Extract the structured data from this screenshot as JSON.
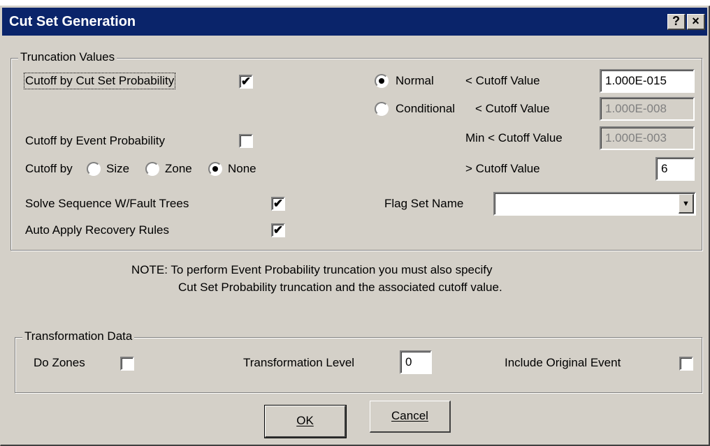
{
  "window": {
    "title": "Cut Set Generation",
    "help_glyph": "?",
    "close_glyph": "×"
  },
  "truncation": {
    "group_label": "Truncation Values",
    "cutset_prob_label": "Cutoff by Cut Set Probability",
    "cutset_prob_checked": true,
    "event_prob_label": "Cutoff by Event Probability",
    "event_prob_checked": false,
    "cutoff_by_label": "Cutoff by",
    "cutoff_by_options": [
      "Size",
      "Zone",
      "None"
    ],
    "cutoff_by_selected": "None",
    "normal_label": "Normal",
    "normal_selected": true,
    "normal_cutoff_label": "< Cutoff Value",
    "normal_cutoff_value": "1.000E-015",
    "conditional_label": "Conditional",
    "conditional_selected": false,
    "conditional_cutoff_label": "< Cutoff Value",
    "conditional_cutoff_value": "1.000E-008",
    "min_cutoff_label": "Min < Cutoff Value",
    "min_cutoff_value": "1.000E-003",
    "gt_cutoff_label": "> Cutoff Value",
    "gt_cutoff_value": "6",
    "solve_sequence_label": "Solve Sequence W/Fault Trees",
    "solve_sequence_checked": true,
    "auto_apply_label": "Auto Apply Recovery Rules",
    "auto_apply_checked": true,
    "flag_set_label": "Flag Set Name",
    "flag_set_value": ""
  },
  "note": {
    "line1": "NOTE: To perform Event Probability truncation you must also specify",
    "line2": "Cut Set Probability truncation and the associated cutoff value."
  },
  "transformation": {
    "group_label": "Transformation Data",
    "do_zones_label": "Do Zones",
    "do_zones_checked": false,
    "level_label": "Transformation Level",
    "level_value": "0",
    "include_original_label": "Include Original Event",
    "include_original_checked": false
  },
  "buttons": {
    "ok": "OK",
    "cancel": "Cancel"
  },
  "icons": {
    "check": "✔",
    "dropdown": "▼"
  }
}
